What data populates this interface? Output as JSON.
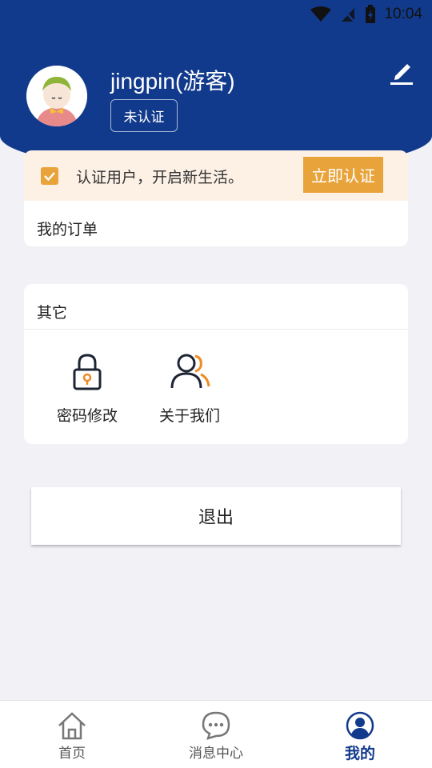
{
  "status_bar": {
    "time": "10:04",
    "icons": [
      "wifi-icon",
      "no-signal-icon",
      "battery-charging-icon"
    ]
  },
  "profile": {
    "username": "jingpin(游客)",
    "status_badge": "未认证",
    "avatar_icon": "cartoon-avatar-icon",
    "edit_icon": "edit-pencil-icon"
  },
  "verify_banner": {
    "text": "认证用户，开启新生活。",
    "button_label": "立即认证"
  },
  "orders": {
    "title": "我的订单"
  },
  "other": {
    "title": "其它",
    "items": [
      {
        "label": "密码修改",
        "icon": "lock-icon"
      },
      {
        "label": "关于我们",
        "icon": "users-icon"
      }
    ]
  },
  "logout_label": "退出",
  "tabbar": {
    "items": [
      {
        "label": "首页",
        "icon": "home-icon"
      },
      {
        "label": "消息中心",
        "icon": "message-icon"
      },
      {
        "label": "我的",
        "icon": "profile-icon",
        "active": true
      }
    ]
  },
  "colors": {
    "primary": "#123a8c",
    "accent": "#e8a33a",
    "banner_bg": "#fdf1e6",
    "page_bg": "#f1f1f6"
  }
}
